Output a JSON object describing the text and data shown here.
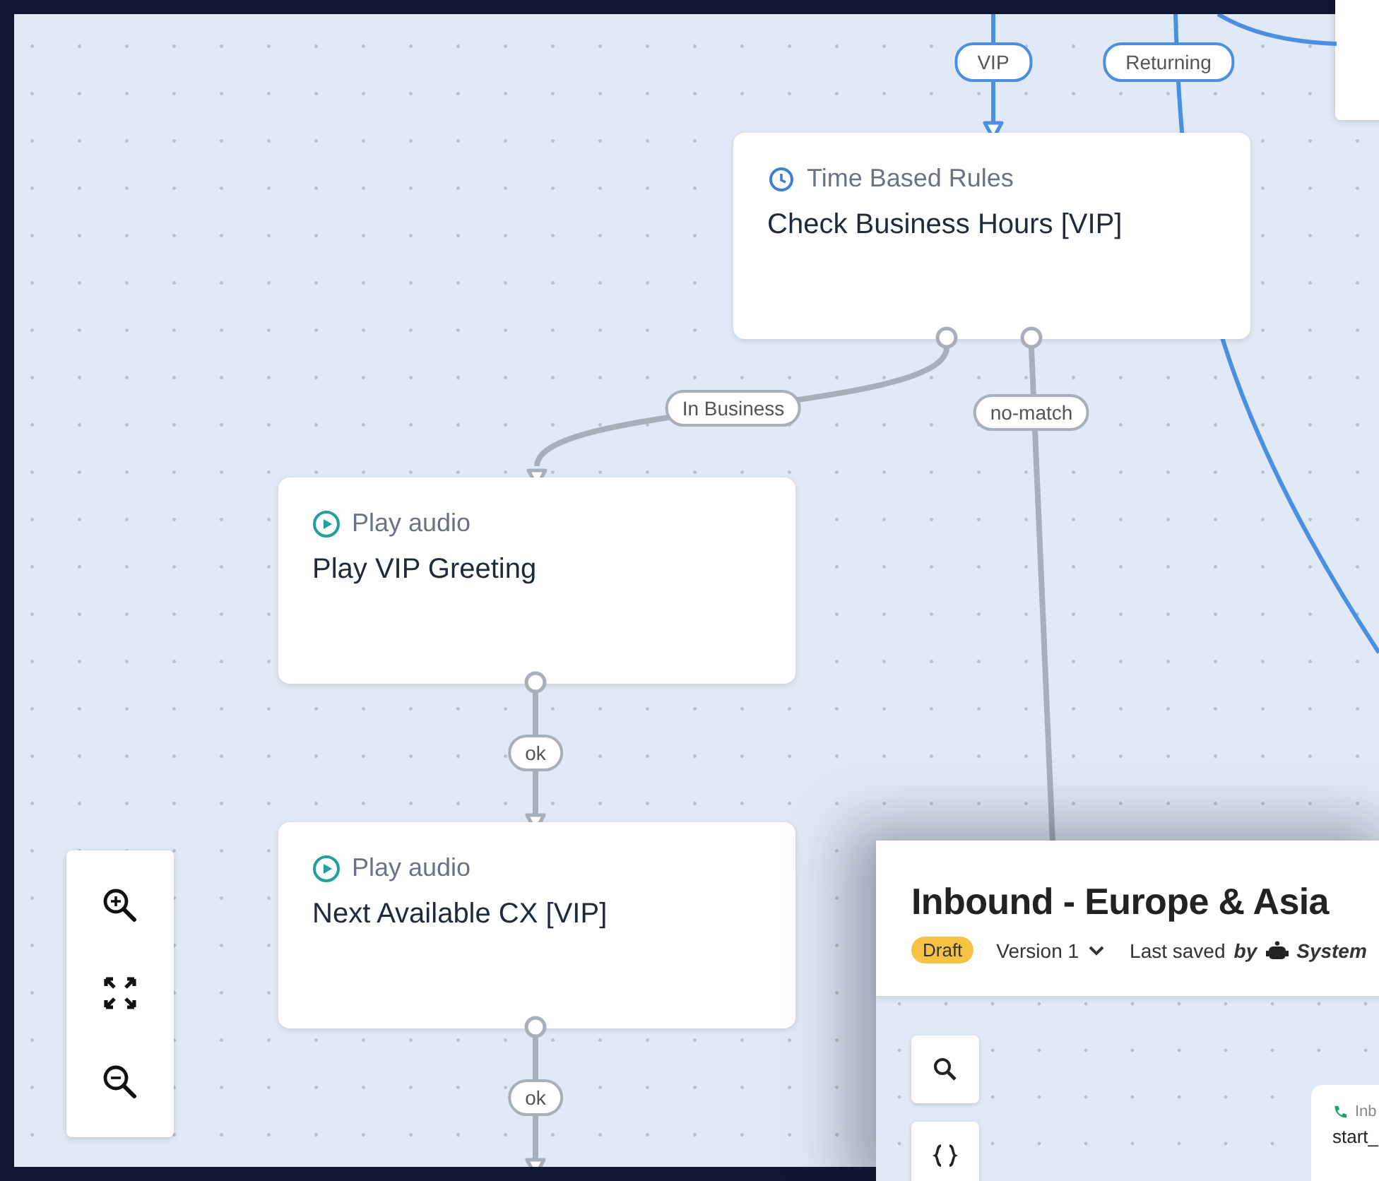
{
  "nodes": [
    {
      "kind": "time_rules",
      "type": "Time Based Rules",
      "title": "Check Business Hours [VIP]"
    },
    {
      "kind": "play_audio",
      "type": "Play audio",
      "title": "Play VIP Greeting"
    },
    {
      "kind": "play_audio",
      "type": "Play audio",
      "title": "Next Available CX [VIP]"
    }
  ],
  "edges": [
    {
      "label": "VIP",
      "highlighted": true
    },
    {
      "label": "Returning",
      "highlighted": true
    },
    {
      "label": "In Business",
      "highlighted": false
    },
    {
      "label": "no-match",
      "highlighted": false
    },
    {
      "label": "ok",
      "highlighted": false
    },
    {
      "label": "ok",
      "highlighted": false
    }
  ],
  "inset_window": {
    "title": "Inbound - Europe & Asia",
    "status": "Draft",
    "version": "Version 1",
    "saved_label": "Last saved",
    "saved_by": "by",
    "saved_user": "System",
    "card": {
      "type": "Inb",
      "title": "start_"
    }
  }
}
